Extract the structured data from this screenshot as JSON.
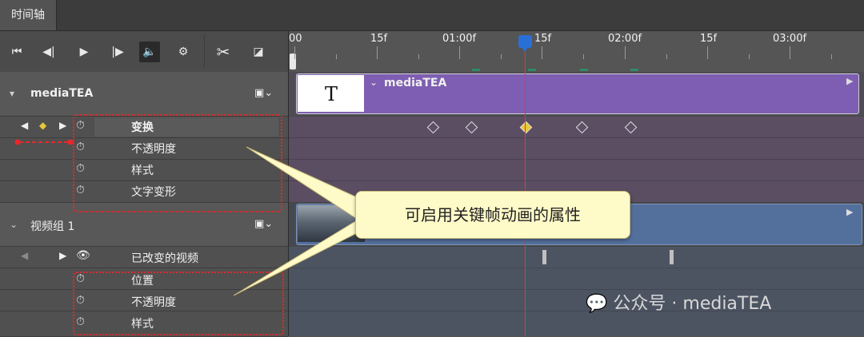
{
  "tab": {
    "label": "时间轴"
  },
  "ruler": {
    "ticks": [
      "00",
      "15f",
      "01:00f",
      "15f",
      "02:00f",
      "15f",
      "03:00f"
    ]
  },
  "tracks": [
    {
      "name": "mediaTEA",
      "clip_label": "mediaTEA",
      "clip_icon": "T",
      "properties": [
        "变换",
        "不透明度",
        "样式",
        "文字变形"
      ]
    },
    {
      "name": "视频组 1",
      "properties": [
        "已改变的视频",
        "位置",
        "不透明度",
        "样式"
      ]
    }
  ],
  "callout": {
    "text": "可启用关键帧动画的属性"
  },
  "watermark": {
    "text": "公众号 · mediaTEA"
  },
  "colors": {
    "text_clip": "#7e5eb2",
    "video_clip": "#53709d",
    "playhead": "#e0383b",
    "callout_border": "#e8282b"
  }
}
